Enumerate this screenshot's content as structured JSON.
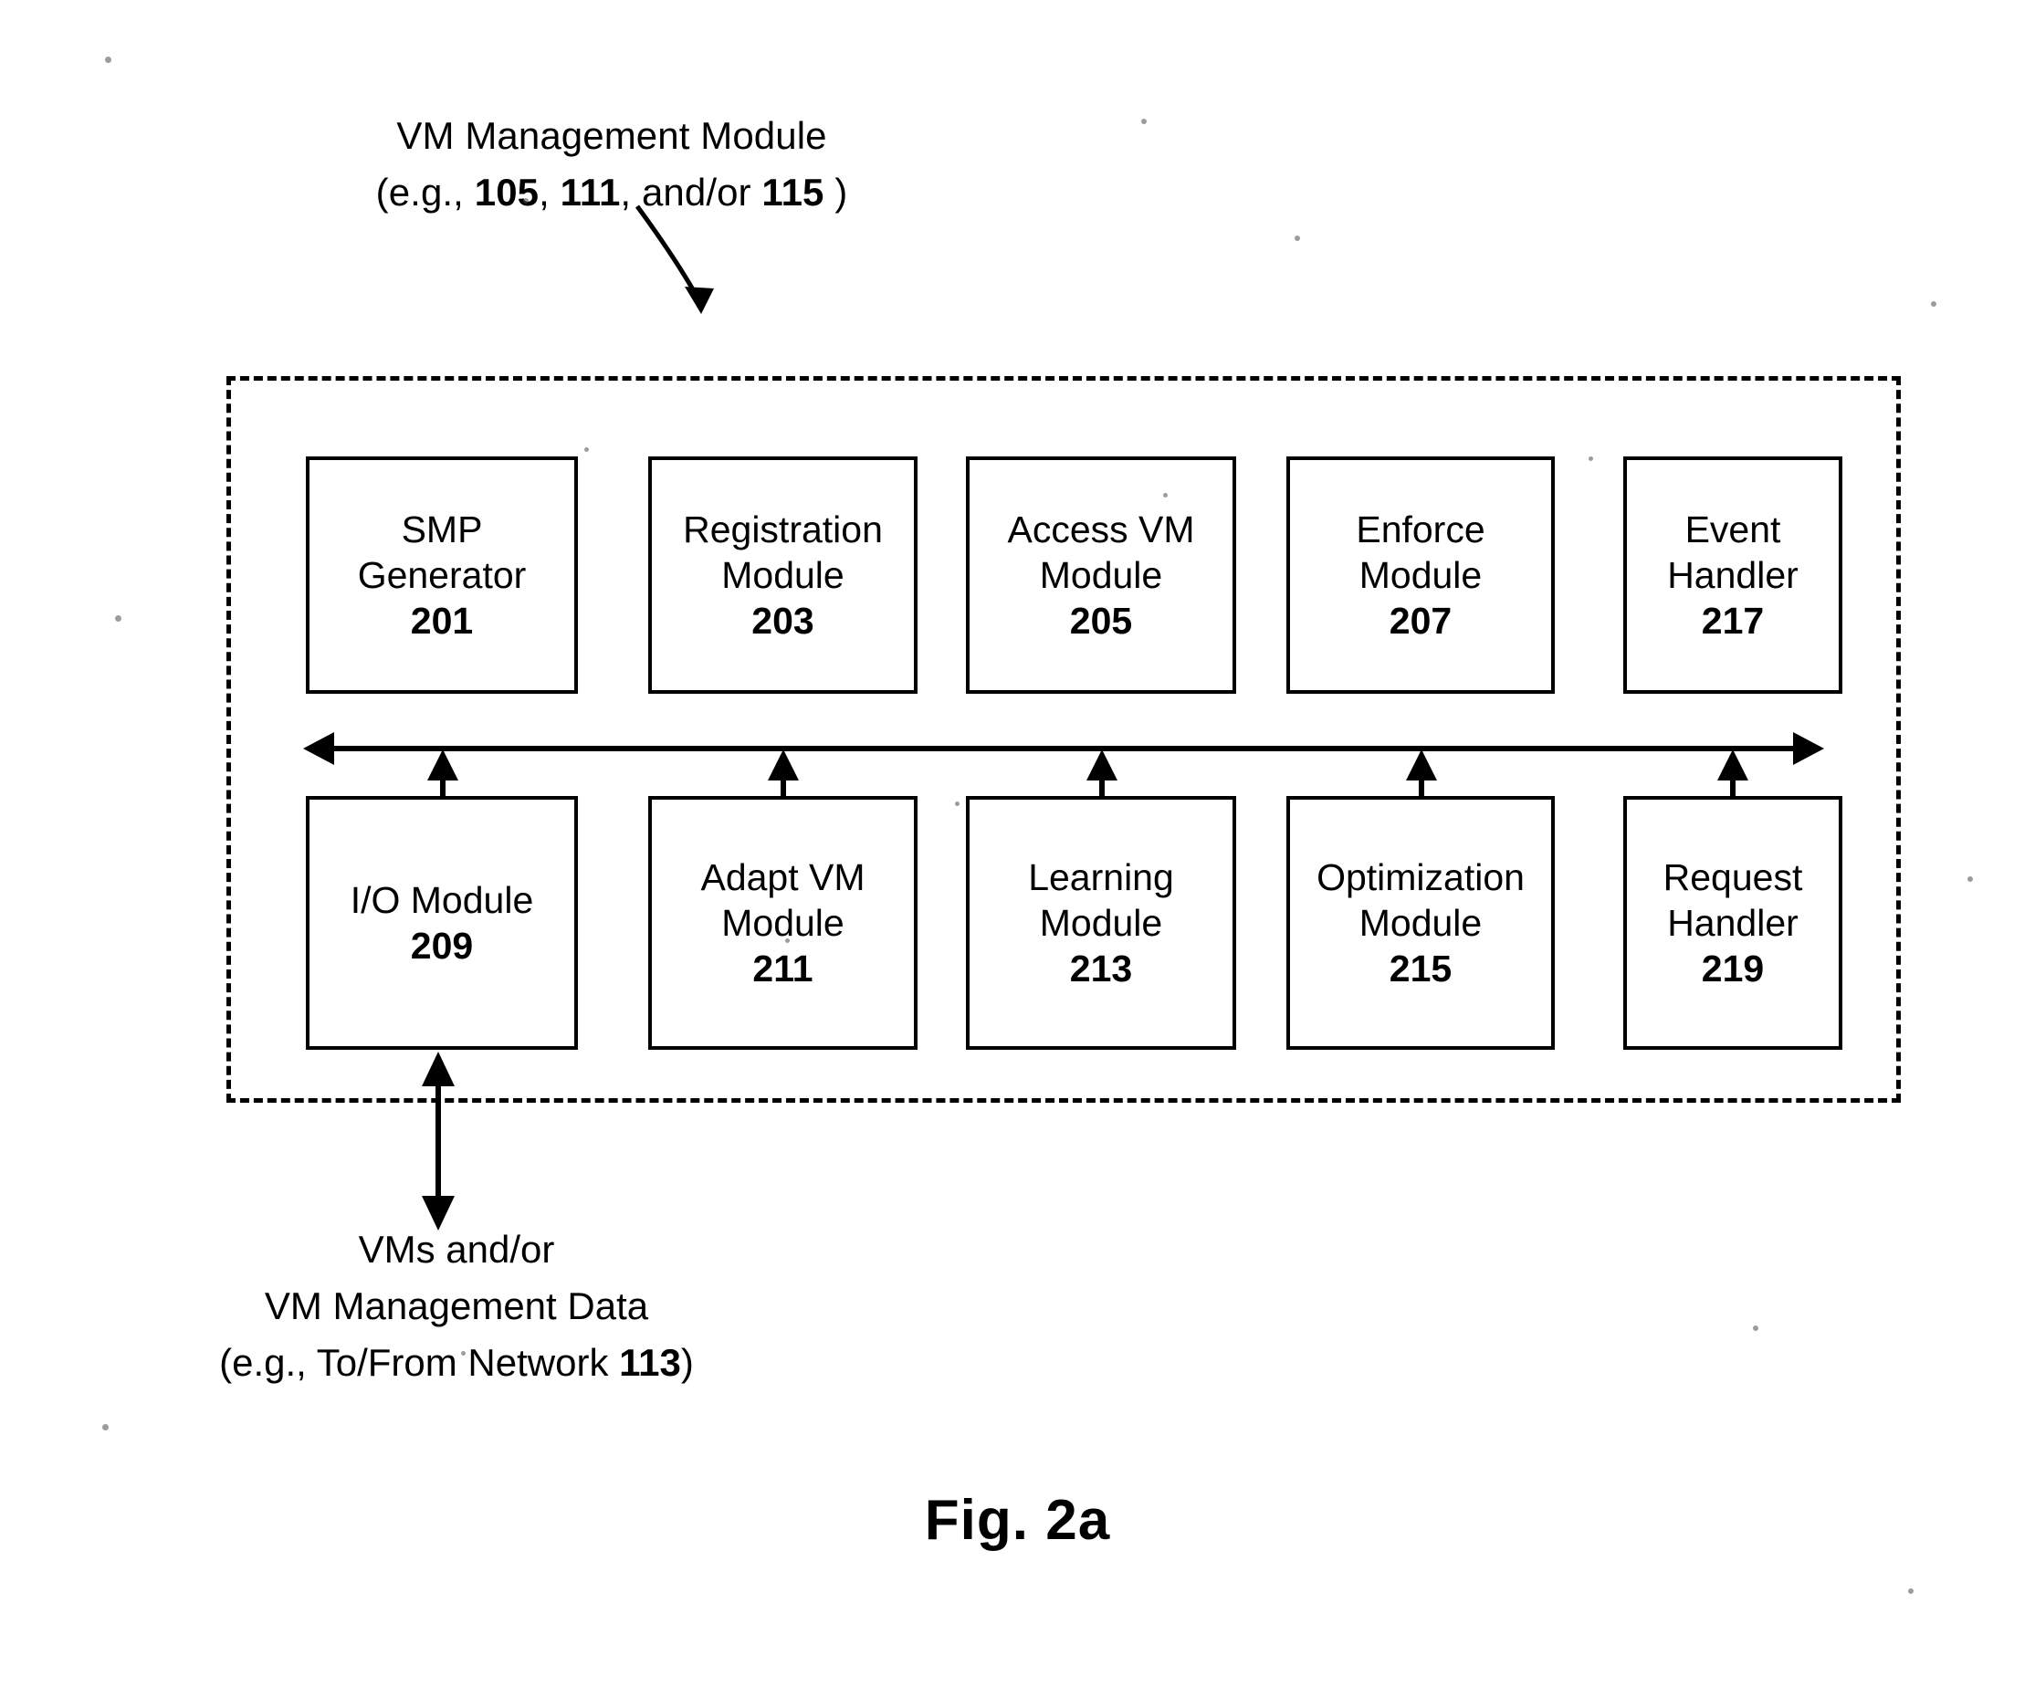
{
  "figure": {
    "label": "Fig. 2a"
  },
  "top_caption": {
    "line1": "VM Management Module",
    "line2_prefix": "(e.g., ",
    "ref1": "105",
    "sep1": ", ",
    "ref2": "111",
    "sep2": ", and/or ",
    "ref3": "115",
    "line2_suffix": " )"
  },
  "container": {
    "name": "VM Management Module"
  },
  "modules": {
    "top_row": [
      {
        "title_line1": "SMP",
        "title_line2": "Generator",
        "number": "201"
      },
      {
        "title_line1": "Registration",
        "title_line2": "Module",
        "number": "203"
      },
      {
        "title_line1": "Access VM",
        "title_line2": "Module",
        "number": "205"
      },
      {
        "title_line1": "Enforce",
        "title_line2": "Module",
        "number": "207"
      },
      {
        "title_line1": "Event",
        "title_line2": "Handler",
        "number": "217"
      }
    ],
    "bottom_row": [
      {
        "title_line1": "I/O Module",
        "title_line2": "",
        "number": "209"
      },
      {
        "title_line1": "Adapt VM",
        "title_line2": "Module",
        "number": "211"
      },
      {
        "title_line1": "Learning",
        "title_line2": "Module",
        "number": "213"
      },
      {
        "title_line1": "Optimization",
        "title_line2": "Module",
        "number": "215"
      },
      {
        "title_line1": "Request",
        "title_line2": "Handler",
        "number": "219"
      }
    ]
  },
  "bottom_caption": {
    "line1": "VMs and/or",
    "line2": "VM Management Data",
    "line3_prefix": "(e.g., To/From Network ",
    "ref": "113",
    "line3_suffix": ")"
  },
  "colors": {
    "ink": "#000000",
    "paper": "#ffffff"
  }
}
